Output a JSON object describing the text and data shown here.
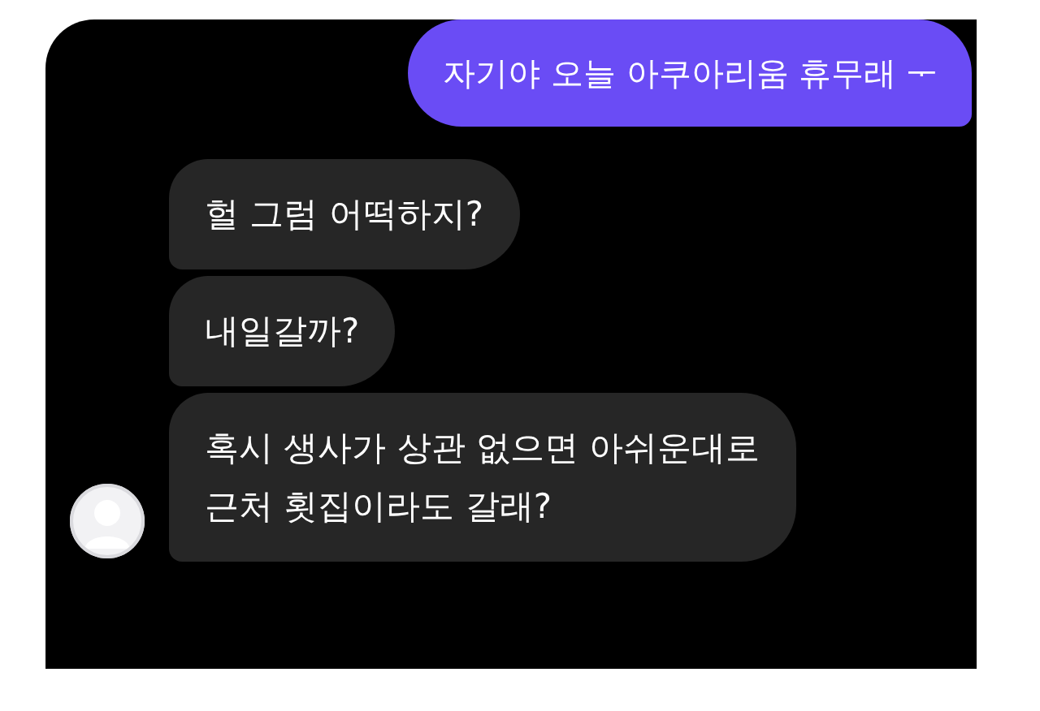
{
  "messages": [
    {
      "kind": "sent",
      "text": "자기야 오늘 아쿠아리움 휴무래 ᅮ"
    },
    {
      "kind": "received",
      "text": "헐 그럼 어떡하지?",
      "avatar": false
    },
    {
      "kind": "received",
      "text": "내일갈까?",
      "avatar": false
    },
    {
      "kind": "received",
      "text": "혹시 생사가 상관 없으면 아쉬운대로\n근처 횟집이라도 갈래?",
      "avatar": true
    }
  ]
}
